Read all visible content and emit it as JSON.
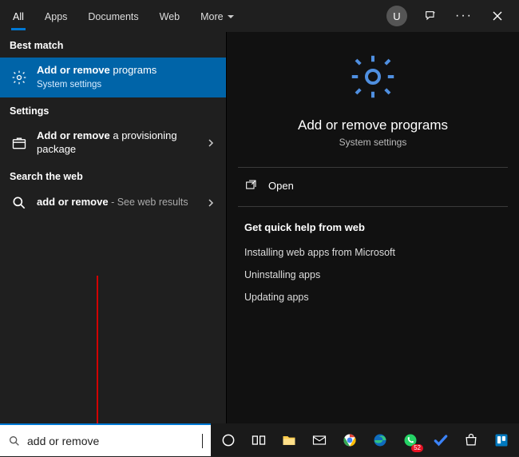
{
  "topbar": {
    "tabs": [
      "All",
      "Apps",
      "Documents",
      "Web",
      "More"
    ],
    "active_tab_index": 0,
    "avatar_letter": "U"
  },
  "left": {
    "best_match_header": "Best match",
    "best_match": {
      "title_bold": "Add or remove",
      "title_rest": " programs",
      "subtitle": "System settings"
    },
    "settings_header": "Settings",
    "settings_item": {
      "title_bold": "Add or remove",
      "title_rest": " a provisioning package"
    },
    "web_header": "Search the web",
    "web_item": {
      "title_bold": "add or remove",
      "suffix": " - See web results"
    }
  },
  "right": {
    "title": "Add or remove programs",
    "subtitle": "System settings",
    "open_label": "Open",
    "help_header": "Get quick help from web",
    "help_links": [
      "Installing web apps from Microsoft",
      "Uninstalling apps",
      "Updating apps"
    ]
  },
  "search": {
    "value": "add or remove"
  },
  "taskbar": {
    "badge_count": "52"
  }
}
